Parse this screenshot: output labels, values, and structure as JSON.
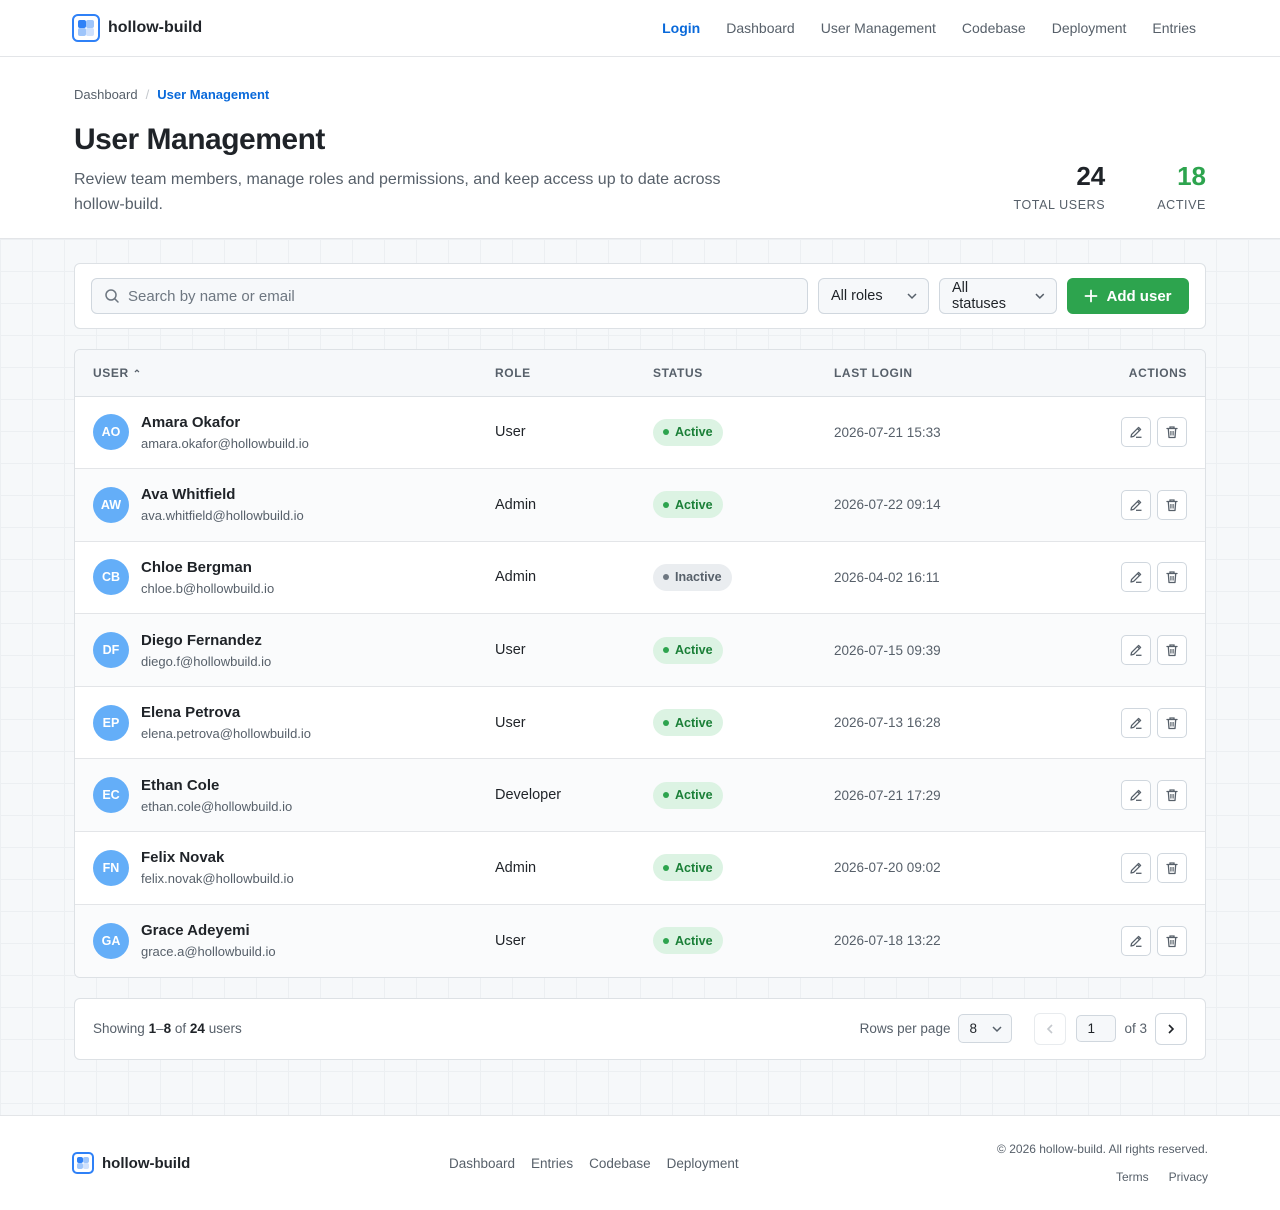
{
  "brand": {
    "name": "hollow-build"
  },
  "nav": [
    {
      "label": "Login",
      "active": true
    },
    {
      "label": "Dashboard"
    },
    {
      "label": "User Management"
    },
    {
      "label": "Codebase"
    },
    {
      "label": "Deployment"
    },
    {
      "label": "Entries"
    }
  ],
  "breadcrumb": {
    "parent": "Dashboard",
    "separator": "/",
    "current": "User Management"
  },
  "page": {
    "title": "User Management",
    "description": "Review team members, manage roles and permissions, and keep access up to date across hollow-build."
  },
  "stats": {
    "total": {
      "value": "24",
      "label": "TOTAL USERS"
    },
    "active": {
      "value": "18",
      "label": "ACTIVE",
      "color": "#2da44e"
    }
  },
  "toolbar": {
    "search_placeholder": "Search by name or email",
    "role_filter": "All roles",
    "status_filter": "All statuses",
    "add_label": "Add user"
  },
  "table": {
    "headers": {
      "user": "USER",
      "role": "ROLE",
      "status": "STATUS",
      "last_login": "LAST LOGIN",
      "actions": "ACTIONS"
    },
    "rows": [
      {
        "initials": "AO",
        "name": "Amara Okafor",
        "email": "amara.okafor@hollowbuild.io",
        "role": "User",
        "status": "Active",
        "last_login": "2026-07-21 15:33"
      },
      {
        "initials": "AW",
        "name": "Ava Whitfield",
        "email": "ava.whitfield@hollowbuild.io",
        "role": "Admin",
        "status": "Active",
        "last_login": "2026-07-22 09:14"
      },
      {
        "initials": "CB",
        "name": "Chloe Bergman",
        "email": "chloe.b@hollowbuild.io",
        "role": "Admin",
        "status": "Inactive",
        "last_login": "2026-04-02 16:11"
      },
      {
        "initials": "DF",
        "name": "Diego Fernandez",
        "email": "diego.f@hollowbuild.io",
        "role": "User",
        "status": "Active",
        "last_login": "2026-07-15 09:39"
      },
      {
        "initials": "EP",
        "name": "Elena Petrova",
        "email": "elena.petrova@hollowbuild.io",
        "role": "User",
        "status": "Active",
        "last_login": "2026-07-13 16:28"
      },
      {
        "initials": "EC",
        "name": "Ethan Cole",
        "email": "ethan.cole@hollowbuild.io",
        "role": "Developer",
        "status": "Active",
        "last_login": "2026-07-21 17:29"
      },
      {
        "initials": "FN",
        "name": "Felix Novak",
        "email": "felix.novak@hollowbuild.io",
        "role": "Admin",
        "status": "Active",
        "last_login": "2026-07-20 09:02"
      },
      {
        "initials": "GA",
        "name": "Grace Adeyemi",
        "email": "grace.a@hollowbuild.io",
        "role": "User",
        "status": "Active",
        "last_login": "2026-07-18 13:22"
      }
    ]
  },
  "pagination": {
    "showing_prefix": "Showing",
    "range_start": "1",
    "range_dash": "–",
    "range_end": "8",
    "of_word": "of",
    "total": "24",
    "suffix": "users",
    "rows_per_page_label": "Rows per page",
    "rows_per_page": "8",
    "current_page": "1",
    "of_pages": "of 3"
  },
  "footer": {
    "brand": "hollow-build",
    "links": [
      "Dashboard",
      "Entries",
      "Codebase",
      "Deployment"
    ],
    "copyright": "© 2026 hollow-build. All rights reserved.",
    "legal": [
      "Terms",
      "Privacy"
    ]
  },
  "colors": {
    "accent": "#0969da",
    "primary_button": "#2da44e",
    "avatar": "#64aef8"
  }
}
